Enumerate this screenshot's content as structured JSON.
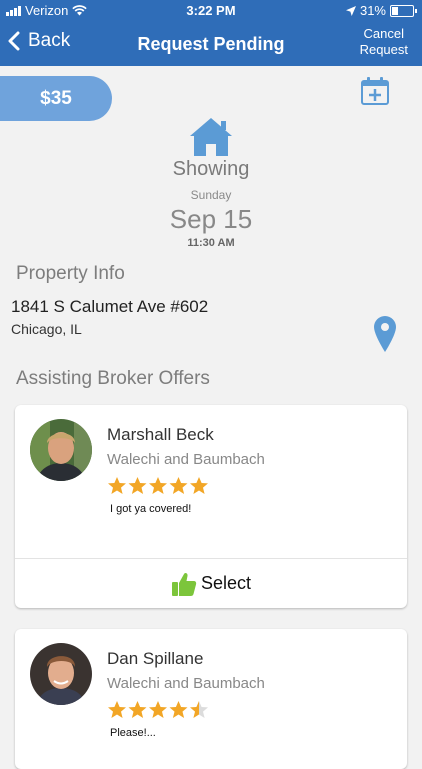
{
  "status_bar": {
    "carrier": "Verizon",
    "time": "3:22 PM",
    "battery_percent": "31%",
    "battery_level": 0.31,
    "icons": [
      "signal-icon",
      "wifi-icon",
      "location-arrow-icon",
      "battery-icon"
    ]
  },
  "nav": {
    "back_label": "Back",
    "title": "Request Pending",
    "cancel_line1": "Cancel",
    "cancel_line2": "Request"
  },
  "request": {
    "price": "$35",
    "type": "Showing",
    "day_of_week": "Sunday",
    "date": "Sep 15",
    "time": "11:30 AM",
    "icons": [
      "calendar-add-icon",
      "house-icon"
    ]
  },
  "property": {
    "section_title": "Property Info",
    "address_line1": "1841 S Calumet Ave #602",
    "address_line2": "Chicago, IL",
    "icon": "map-pin-icon"
  },
  "offers": {
    "section_title": "Assisting Broker Offers",
    "brokers": [
      {
        "name": "Marshall Beck",
        "firm": "Walechi and Baumbach",
        "rating": 5,
        "comment": "I got ya covered!",
        "select_label": "Select"
      },
      {
        "name": "Dan Spillane",
        "firm": "Walechi and Baumbach",
        "rating": 4.5,
        "comment": "Please!..."
      }
    ]
  },
  "colors": {
    "brand_blue": "#2f6db8",
    "light_blue": "#6fa3dc",
    "star_gold": "#f2a626",
    "thumb_green": "#7cc53b"
  }
}
